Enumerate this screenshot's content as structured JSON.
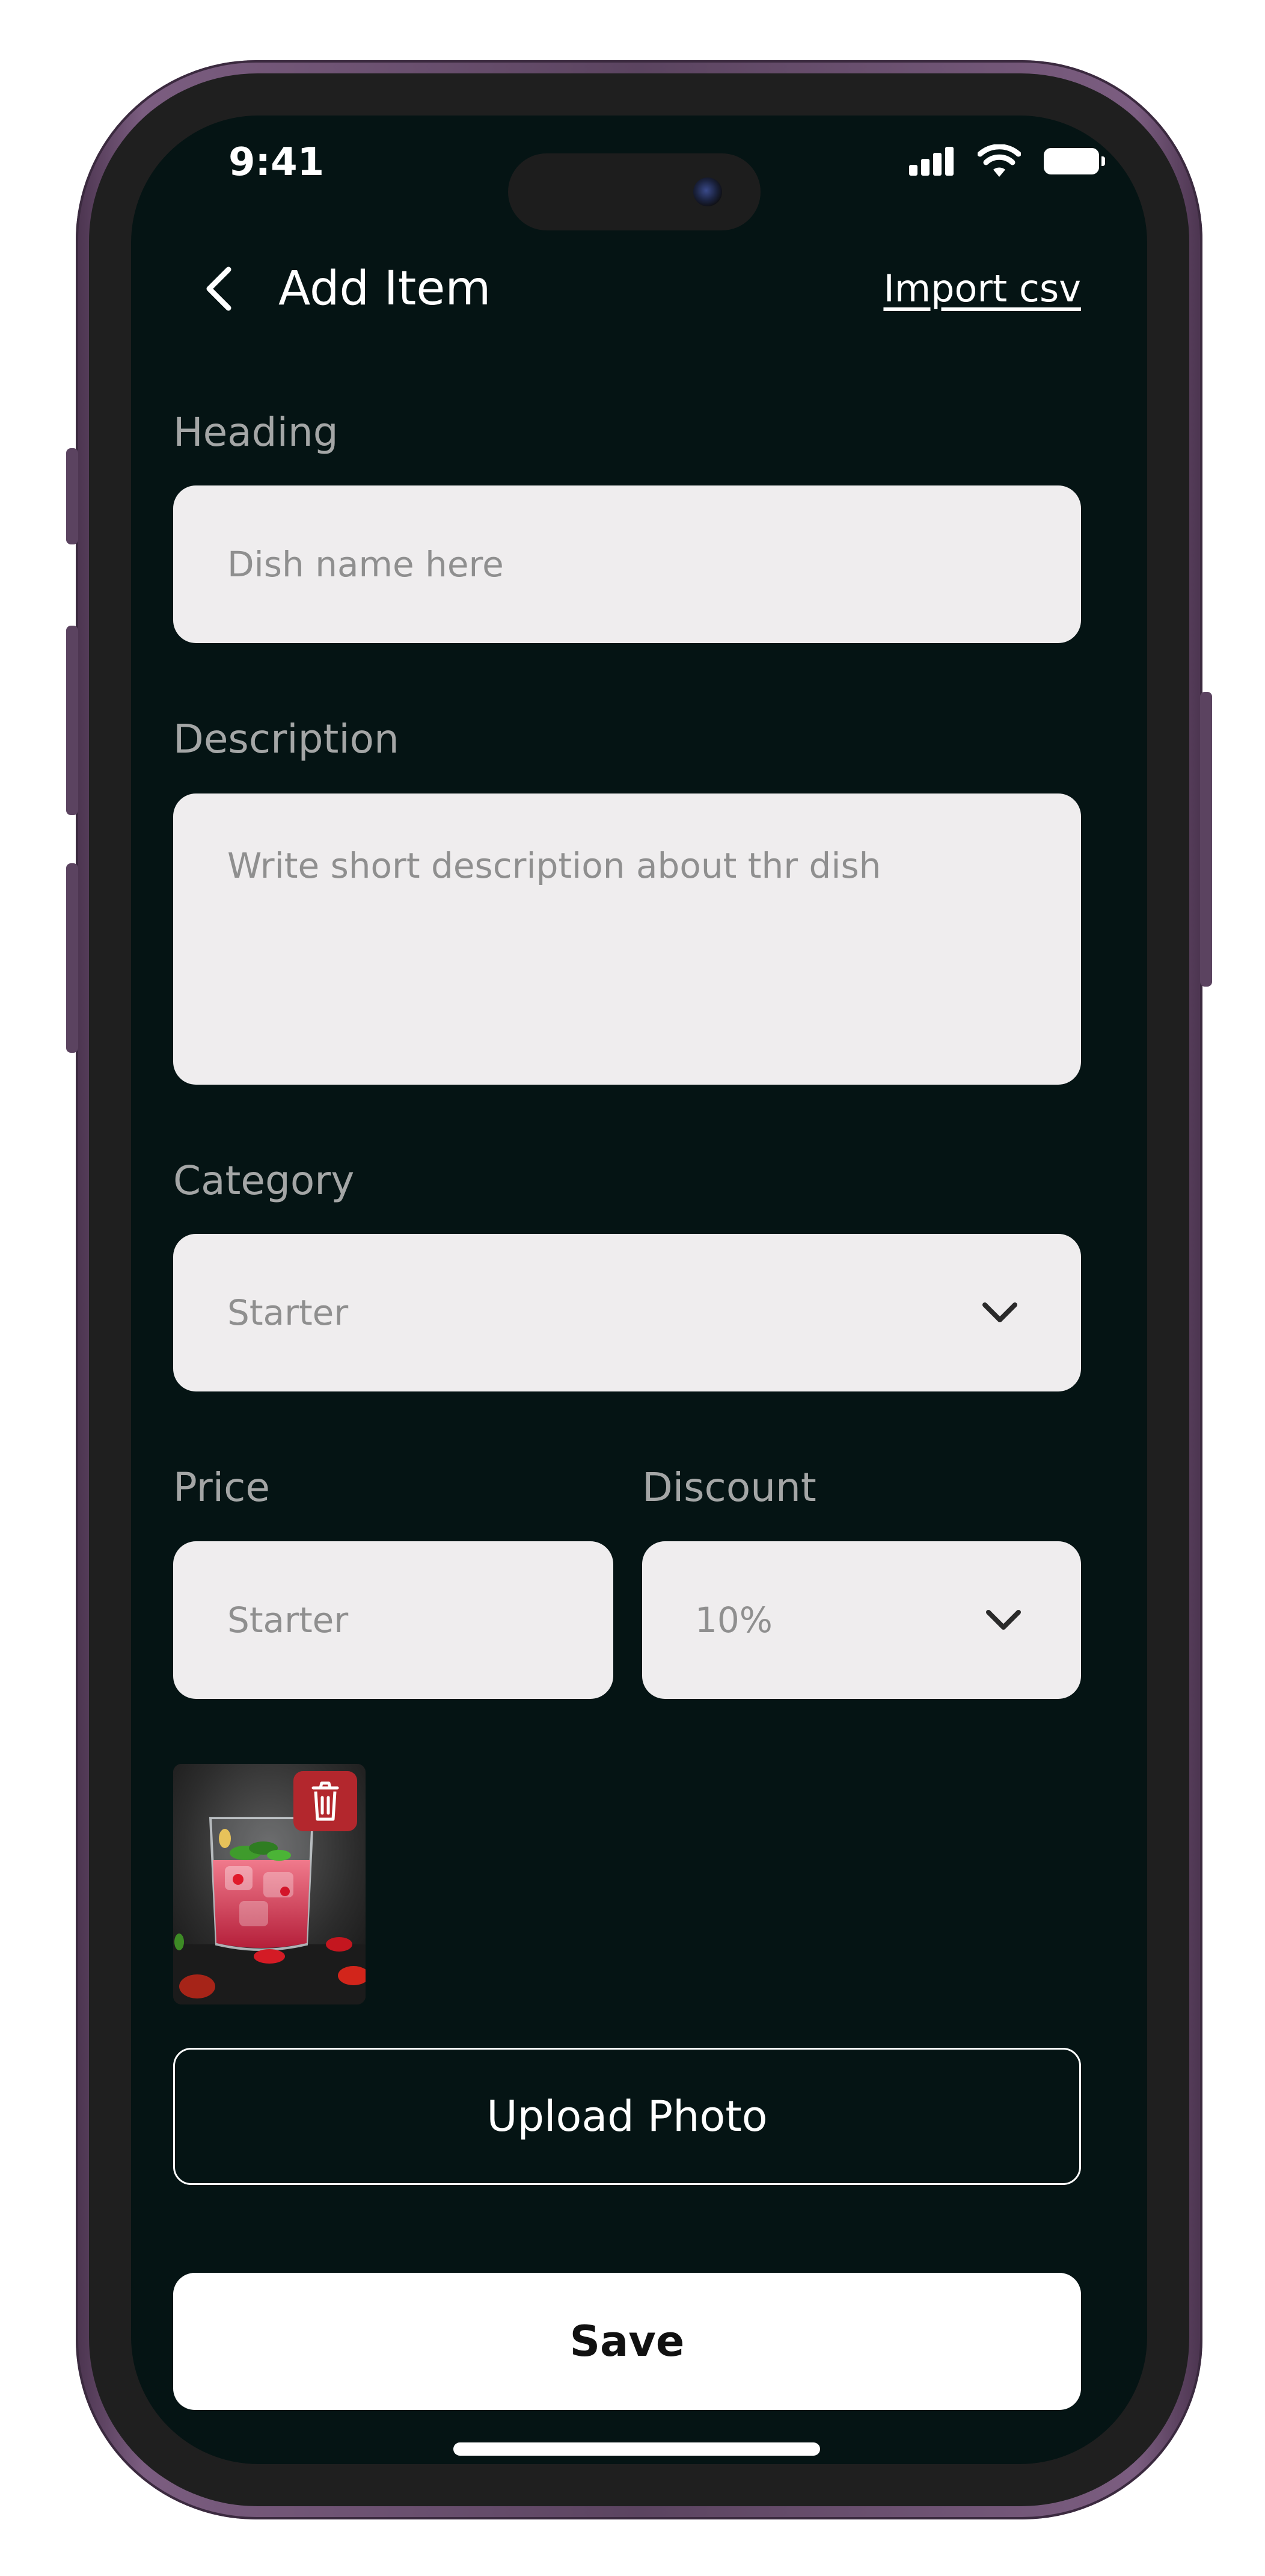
{
  "status_bar": {
    "time": "9:41"
  },
  "header": {
    "title": "Add Item",
    "import_link": "Import csv",
    "back_icon": "chevron-left-icon"
  },
  "form": {
    "heading": {
      "label": "Heading",
      "placeholder": "Dish name here"
    },
    "description": {
      "label": "Description",
      "placeholder": "Write short description about thr dish"
    },
    "category": {
      "label": "Category",
      "selected": "Starter"
    },
    "price": {
      "label": "Price",
      "placeholder": "Starter"
    },
    "discount": {
      "label": "Discount",
      "selected": "10%"
    }
  },
  "photo": {
    "delete_icon": "trash-icon"
  },
  "buttons": {
    "upload": "Upload Photo",
    "save": "Save"
  },
  "colors": {
    "screen_background": "#051414",
    "input_background": "#efedee",
    "label": "#a4a6a6",
    "placeholder": "#8f8f8f",
    "delete_badge": "#b3272d",
    "frame": "#6e5373"
  }
}
